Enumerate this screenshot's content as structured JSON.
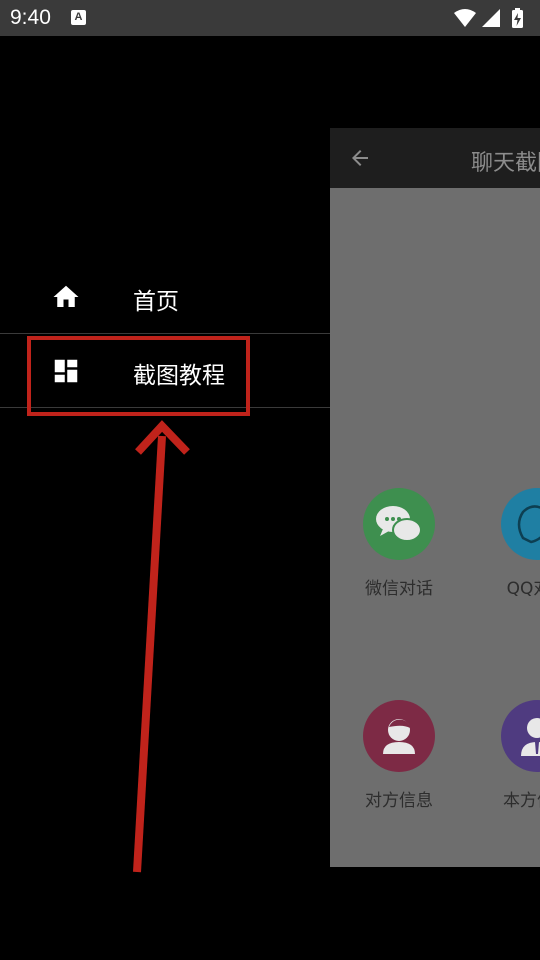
{
  "status_bar": {
    "time": "9:40",
    "notification_icon_letter": "A",
    "icons": [
      "wifi-icon",
      "cell-signal-icon",
      "battery-charging-icon"
    ]
  },
  "drawer": {
    "items": [
      {
        "label": "首页",
        "icon": "home-icon"
      },
      {
        "label": "截图教程",
        "icon": "dashboard-icon"
      }
    ]
  },
  "app_panel": {
    "title": "聊天截图",
    "features": [
      {
        "label": "微信对话",
        "icon": "wechat-chat-icon",
        "color": "#3e8f4f"
      },
      {
        "label": "QQ对话",
        "icon": "qq-chat-icon",
        "color": "#1f7fa3"
      },
      {
        "label": "对方信息",
        "icon": "contact-info-icon",
        "color": "#7d2a45"
      },
      {
        "label": "本方信息",
        "icon": "my-info-icon",
        "color": "#4f3b80"
      }
    ]
  },
  "annotation": {
    "color": "#c0231b"
  }
}
